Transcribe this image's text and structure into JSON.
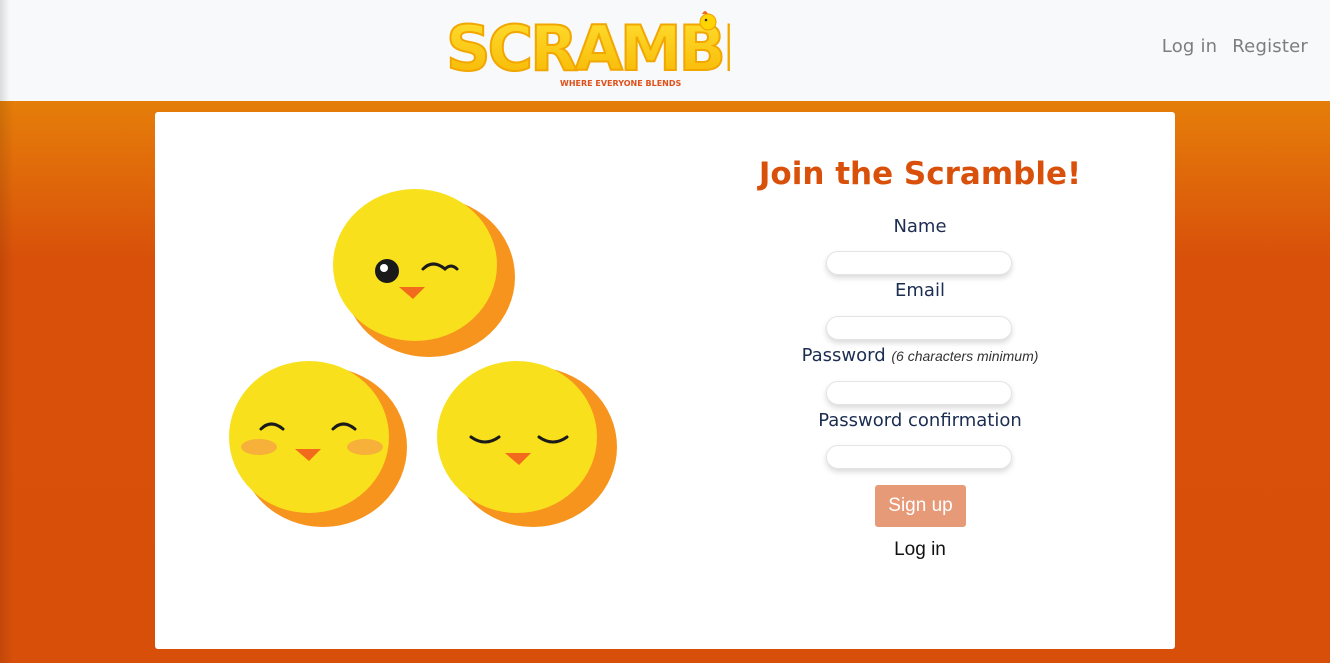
{
  "brand": {
    "name": "SCRAMBLE",
    "tagline": "WHERE EVERYONE BLENDS"
  },
  "nav": {
    "login": "Log in",
    "register": "Register"
  },
  "form": {
    "title": "Join the Scramble!",
    "name_label": "Name",
    "email_label": "Email",
    "password_label": "Password",
    "password_hint": "(6 characters minimum)",
    "confirm_label": "Password confirmation",
    "name_value": "",
    "email_value": "",
    "password_value": "",
    "confirm_value": "",
    "submit_label": "Sign up",
    "login_link": "Log in"
  },
  "colors": {
    "brand_orange": "#d8500a",
    "gradient_top": "#ea9a06",
    "button": "#e69a78",
    "label": "#1c2d52",
    "chick_yellow": "#f8e01c",
    "chick_shadow": "#f7941d"
  },
  "illustration": "three-chicks"
}
